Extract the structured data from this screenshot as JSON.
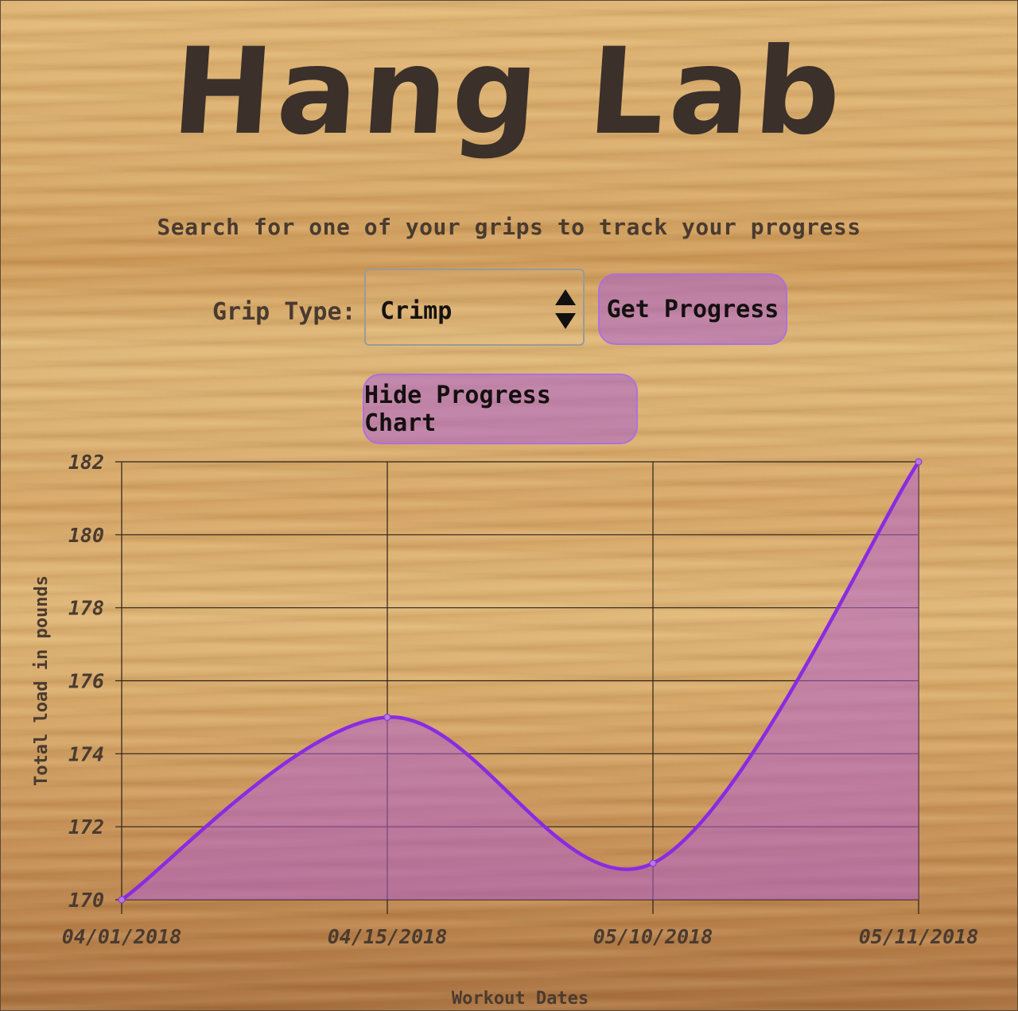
{
  "header": {
    "title": "Hang Lab",
    "subtitle": "Search for one of your grips to track your progress"
  },
  "form": {
    "grip_label": "Grip Type:",
    "grip_select_value": "Crimp",
    "get_progress_label": "Get Progress",
    "hide_chart_label": "Hide Progress Chart"
  },
  "icons": {
    "select_arrows": "up-down-arrows-icon"
  },
  "colors": {
    "accent": "#8a2be2",
    "fill": "#b060d0",
    "button_bg": "#b07ad0"
  },
  "chart_data": {
    "type": "area",
    "title": "",
    "xlabel": "Workout Dates",
    "ylabel": "Total load in pounds",
    "categories": [
      "04/01/2018",
      "04/15/2018",
      "05/10/2018",
      "05/11/2018"
    ],
    "series": [
      {
        "values": [
          170,
          175,
          171,
          182
        ]
      }
    ],
    "ylim": [
      170,
      182
    ],
    "yticks": [
      170,
      172,
      174,
      176,
      178,
      180,
      182
    ],
    "grid": true,
    "legend": "none"
  }
}
